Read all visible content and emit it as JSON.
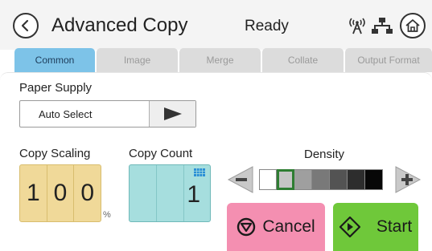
{
  "header": {
    "title": "Advanced Copy",
    "status": "Ready",
    "icons": [
      "back-icon",
      "wireless-icon",
      "wired-network-icon",
      "home-icon"
    ]
  },
  "tabs": [
    {
      "label": "Common",
      "active": true
    },
    {
      "label": "Image",
      "active": false
    },
    {
      "label": "Merge",
      "active": false
    },
    {
      "label": "Collate",
      "active": false
    },
    {
      "label": "Output Format",
      "active": false
    }
  ],
  "paper_supply": {
    "label": "Paper Supply",
    "value": "Auto Select"
  },
  "copy_scaling": {
    "label": "Copy Scaling",
    "digits": [
      "1",
      "0",
      "0"
    ],
    "unit": "%"
  },
  "copy_count": {
    "label": "Copy Count",
    "value": "1"
  },
  "density": {
    "label": "Density",
    "levels": 7,
    "selected_level": 2
  },
  "actions": {
    "cancel_label": "Cancel",
    "start_label": "Start"
  },
  "colors": {
    "active_tab": "#7dc3e8",
    "scaling_box": "#f0d999",
    "count_box": "#a6dede",
    "cancel": "#f48fb1",
    "start": "#6fc83a",
    "density_selected": "#2e7d32"
  }
}
